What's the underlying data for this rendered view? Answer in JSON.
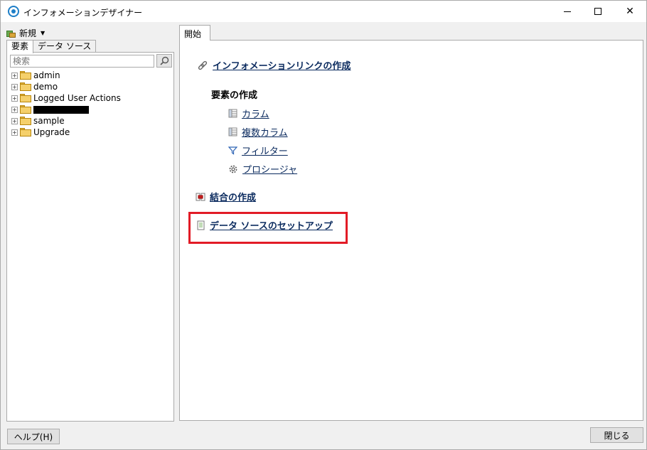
{
  "window": {
    "title": "インフォメーションデザイナー"
  },
  "toolbar": {
    "new_label": "新規"
  },
  "left": {
    "tabs": [
      "要素",
      "データ ソース"
    ],
    "search": {
      "placeholder": "検索"
    },
    "tree": [
      {
        "label": "admin",
        "redacted": false
      },
      {
        "label": "demo",
        "redacted": false
      },
      {
        "label": "Logged User Actions",
        "redacted": false
      },
      {
        "label": "",
        "redacted": true
      },
      {
        "label": "sample",
        "redacted": false
      },
      {
        "label": "Upgrade",
        "redacted": false
      }
    ]
  },
  "right": {
    "tab": "開始",
    "create_info_link": "インフォメーションリンクの作成",
    "element_heading": "要素の作成",
    "elements": {
      "column": "カラム",
      "multi_column": "複数カラム",
      "filter": "フィルター",
      "procedure": "プロシージャ"
    },
    "create_join": "結合の作成",
    "datasource_setup": "データ ソースのセットアップ"
  },
  "footer": {
    "help": "ヘルプ(H)",
    "close": "閉じる"
  },
  "colors": {
    "link": "#0a2a5e",
    "highlight": "#e21b26"
  }
}
